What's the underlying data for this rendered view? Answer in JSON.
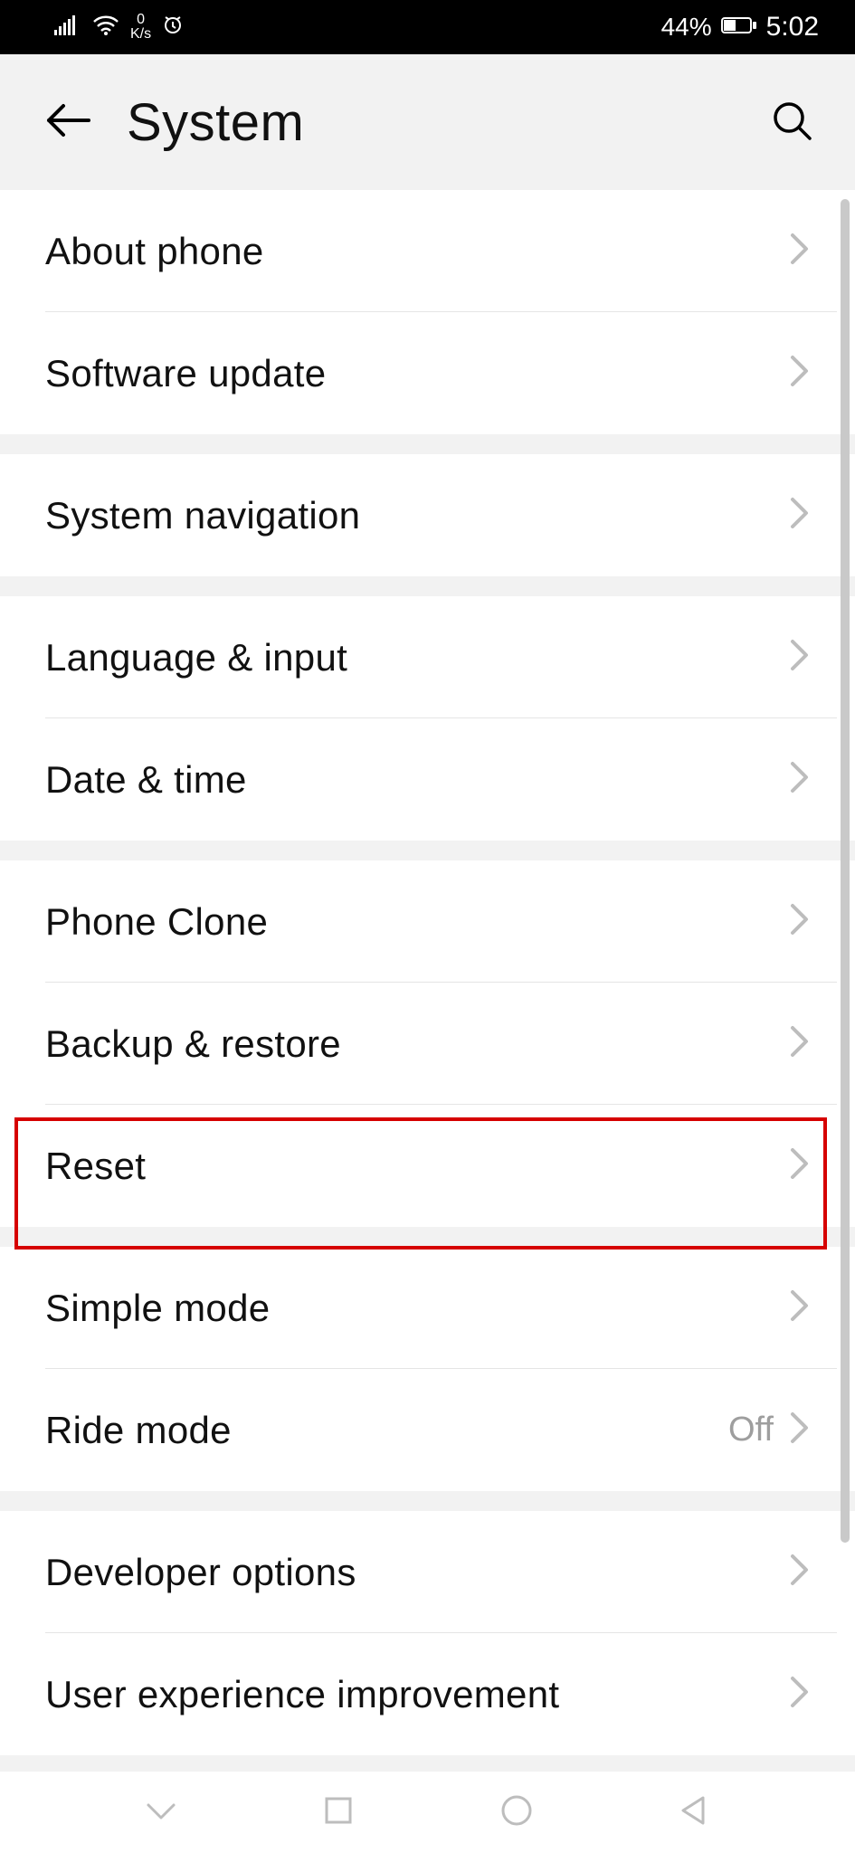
{
  "status": {
    "network_speed_top": "0",
    "network_speed_label": "K/s",
    "battery_percent": "44%",
    "time": "5:02"
  },
  "header": {
    "title": "System"
  },
  "groups": [
    {
      "items": [
        {
          "key": "about-phone",
          "label": "About phone"
        },
        {
          "key": "software-update",
          "label": "Software update"
        }
      ]
    },
    {
      "items": [
        {
          "key": "system-navigation",
          "label": "System navigation"
        }
      ]
    },
    {
      "items": [
        {
          "key": "language-input",
          "label": "Language & input"
        },
        {
          "key": "date-time",
          "label": "Date & time"
        }
      ]
    },
    {
      "items": [
        {
          "key": "phone-clone",
          "label": "Phone Clone"
        },
        {
          "key": "backup-restore",
          "label": "Backup & restore"
        },
        {
          "key": "reset",
          "label": "Reset",
          "highlighted": true
        }
      ]
    },
    {
      "items": [
        {
          "key": "simple-mode",
          "label": "Simple mode"
        },
        {
          "key": "ride-mode",
          "label": "Ride mode",
          "value": "Off"
        }
      ]
    },
    {
      "items": [
        {
          "key": "developer-options",
          "label": "Developer options"
        },
        {
          "key": "user-experience-improvement",
          "label": "User experience improvement"
        }
      ]
    }
  ]
}
